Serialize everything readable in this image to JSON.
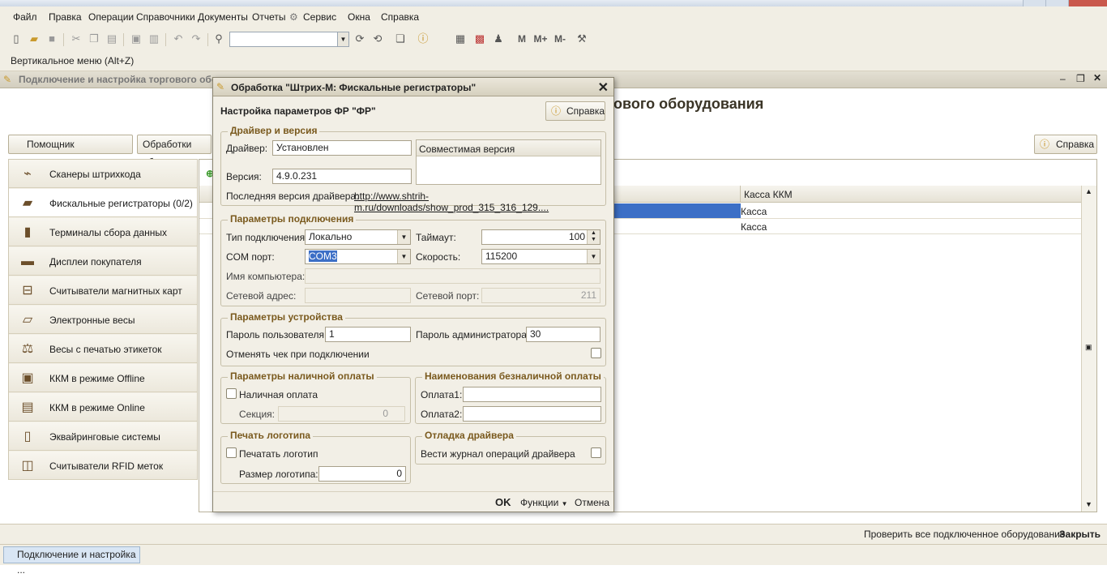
{
  "menu": [
    "Файл",
    "Правка",
    "Операции",
    "Справочники",
    "Документы",
    "Отчеты",
    "Сервис",
    "Окна",
    "Справка"
  ],
  "vertical_menu": "Вертикальное меню (Alt+Z)",
  "doc_title": "Подключение и настройка торгового оборудования",
  "main_title": "ового оборудования",
  "buttons": {
    "assistant": "Помощник подключения",
    "processing": "Обработки обслу",
    "help": "Справка"
  },
  "equipment_types": [
    {
      "label": "Сканеры штрихкода",
      "icon": "barcode-scanner-icon"
    },
    {
      "label": "Фискальные регистраторы (0/2)",
      "icon": "fiscal-register-icon"
    },
    {
      "label": "Терминалы сбора данных",
      "icon": "data-terminal-icon"
    },
    {
      "label": "Дисплеи покупателя",
      "icon": "customer-display-icon"
    },
    {
      "label": "Считыватели магнитных карт",
      "icon": "card-reader-icon"
    },
    {
      "label": "Электронные весы",
      "icon": "scales-icon"
    },
    {
      "label": "Весы с печатью этикеток",
      "icon": "label-scales-icon"
    },
    {
      "label": "ККМ в режиме Offline",
      "icon": "kkm-offline-icon"
    },
    {
      "label": "ККМ в режиме Online",
      "icon": "kkm-online-icon"
    },
    {
      "label": "Эквайринговые системы",
      "icon": "acquiring-icon"
    },
    {
      "label": "Считыватели RFID меток",
      "icon": "rfid-icon"
    }
  ],
  "grid": {
    "column": "Касса ККМ",
    "rows": [
      "Касса",
      "Касса"
    ]
  },
  "status": {
    "check_all": "Проверить все подключенное оборудование",
    "close": "Закрыть"
  },
  "taskbar": "Подключение и настройка ...",
  "dialog": {
    "title": "Обработка \"Штрих-М: Фискальные регистраторы\"",
    "header": "Настройка параметров ФР \"ФР\"",
    "help": "Справка",
    "driver": {
      "section": "Драйвер и версия",
      "driver_label": "Драйвер:",
      "driver_value": "Установлен",
      "version_label": "Версия:",
      "version_value": "4.9.0.231",
      "compatible": "Совместимая версия",
      "latest_label": "Последняя версия драйвера:",
      "latest_link": "http://www.shtrih-m.ru/downloads/show_prod_315_316_129...."
    },
    "connection": {
      "section": "Параметры подключения",
      "type_label": "Тип подключения:",
      "type_value": "Локально",
      "timeout_label": "Таймаут:",
      "timeout_value": "100",
      "com_label": "COM порт:",
      "com_value": "COM3",
      "speed_label": "Скорость:",
      "speed_value": "115200",
      "computer_label": "Имя компьютера:",
      "address_label": "Сетевой адрес:",
      "port_label": "Сетевой порт:",
      "port_value": "211"
    },
    "device": {
      "section": "Параметры устройства",
      "user_pwd_label": "Пароль пользователя:",
      "user_pwd": "1",
      "admin_pwd_label": "Пароль администратора:",
      "admin_pwd": "30",
      "cancel_check": "Отменять чек при подключении"
    },
    "cash": {
      "section": "Параметры наличной оплаты",
      "cash_pay": "Наличная оплата",
      "section_label": "Секция:",
      "section_value": "0"
    },
    "noncash": {
      "section": "Наименования безналичной оплаты",
      "pay1": "Оплата1:",
      "pay2": "Оплата2:"
    },
    "logo": {
      "section": "Печать логотипа",
      "print_logo": "Печатать логотип",
      "size_label": "Размер логотипа:",
      "size_value": "0"
    },
    "debug": {
      "section": "Отладка драйвера",
      "log": "Вести журнал операций драйвера"
    },
    "footer": {
      "ok": "OK",
      "functions": "Функции",
      "cancel": "Отмена"
    }
  }
}
